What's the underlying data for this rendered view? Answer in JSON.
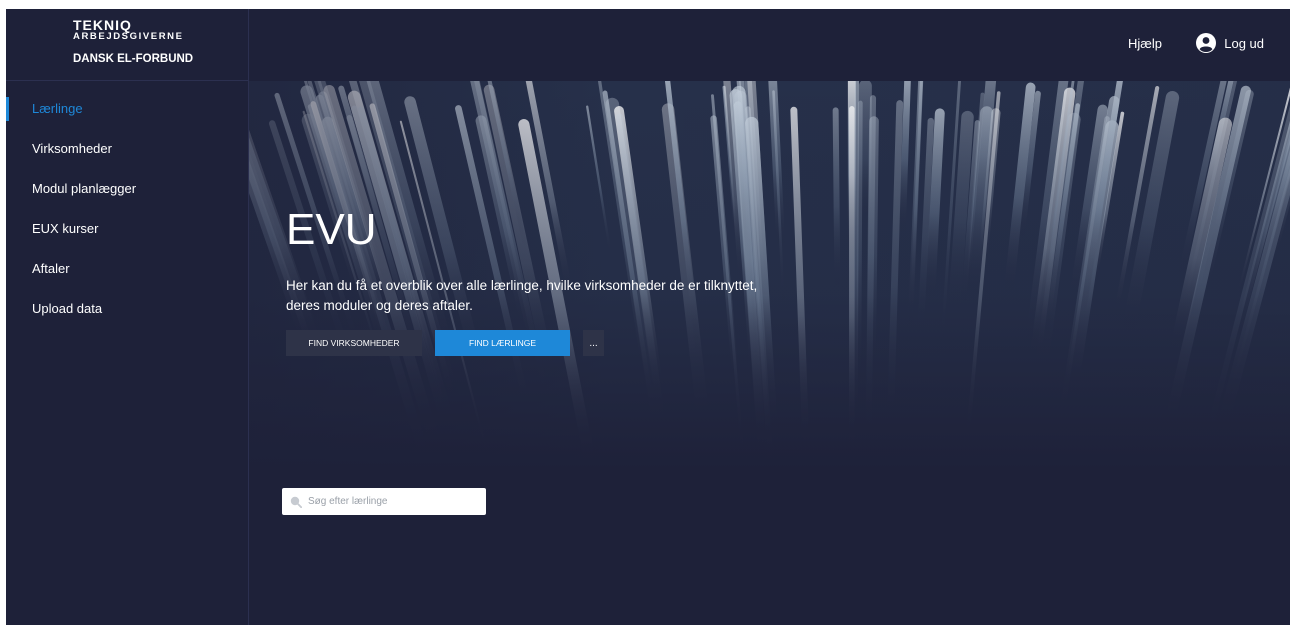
{
  "logo": {
    "line1": "TEKNIQ",
    "line2": "ARBEJDSGIVERNE",
    "line3": "DANSK EL-FORBUND"
  },
  "sidebar": {
    "items": [
      {
        "label": "Lærlinge",
        "active": true
      },
      {
        "label": "Virksomheder",
        "active": false
      },
      {
        "label": "Modul planlægger",
        "active": false
      },
      {
        "label": "EUX kurser",
        "active": false
      },
      {
        "label": "Aftaler",
        "active": false
      },
      {
        "label": "Upload data",
        "active": false
      }
    ]
  },
  "topbar": {
    "help_label": "Hjælp",
    "logout_label": "Log ud",
    "logout_icon": "user-circle-icon"
  },
  "hero": {
    "title": "EVU",
    "description": "Her kan du få et overblik over alle lærlinge, hvilke virksomheder de er tilknyttet, deres moduler og deres aftaler.",
    "buttons": {
      "find_companies": "FIND VIRKSOMHEDER",
      "find_apprentices": "FIND LÆRLINGE",
      "more": "..."
    }
  },
  "search": {
    "placeholder": "Søg efter lærlinge",
    "value": "",
    "icon": "search-icon"
  },
  "colors": {
    "background": "#1e2139",
    "accent": "#1e88d8",
    "button_dark": "#2e3348"
  }
}
